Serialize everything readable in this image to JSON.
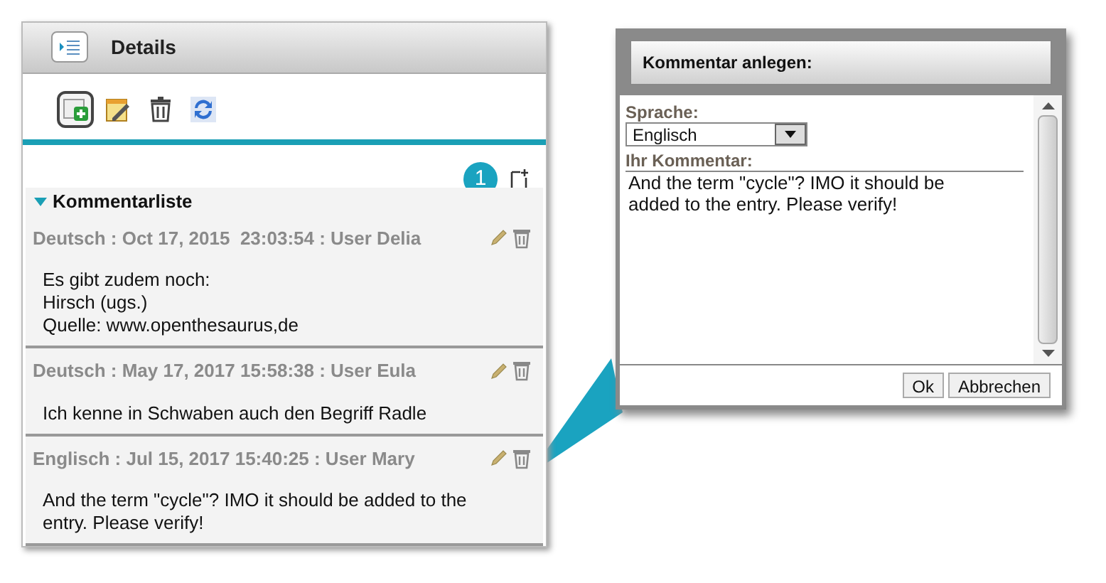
{
  "panel": {
    "title": "Details",
    "toolbar": [
      {
        "kind": "add",
        "selected": true
      },
      {
        "kind": "edit",
        "selected": false
      },
      {
        "kind": "delete",
        "selected": false
      },
      {
        "kind": "refresh",
        "selected": false
      }
    ],
    "badge": "1",
    "list": {
      "title": "Kommentarliste",
      "expanded": true
    },
    "comments": [
      {
        "header": "Deutsch : Oct 17, 2015  23:03:54 : User Delia",
        "body": [
          "Es gibt zudem noch:",
          "Hirsch (ugs.)",
          "Quelle: www.openthesaurus,de"
        ]
      },
      {
        "header": "Deutsch : May 17, 2017 15:58:38 : User Eula",
        "body": [
          "Ich kenne in Schwaben auch den Begriff Radle"
        ]
      },
      {
        "header": "Englisch : Jul 15, 2017 15:40:25 : User Mary",
        "body": [
          "And the term \"cycle\"? IMO it should be added to the",
          "entry. Please verify!"
        ]
      }
    ]
  },
  "dialog": {
    "title": "Kommentar anlegen:",
    "language_label": "Sprache:",
    "language": "Englisch",
    "comment_label": "Ihr Kommentar:",
    "comment": "And the term \"cycle\"? IMO it should be added to the entry. Please verify!",
    "buttons": [
      "Ok",
      "Abbrechen"
    ]
  }
}
